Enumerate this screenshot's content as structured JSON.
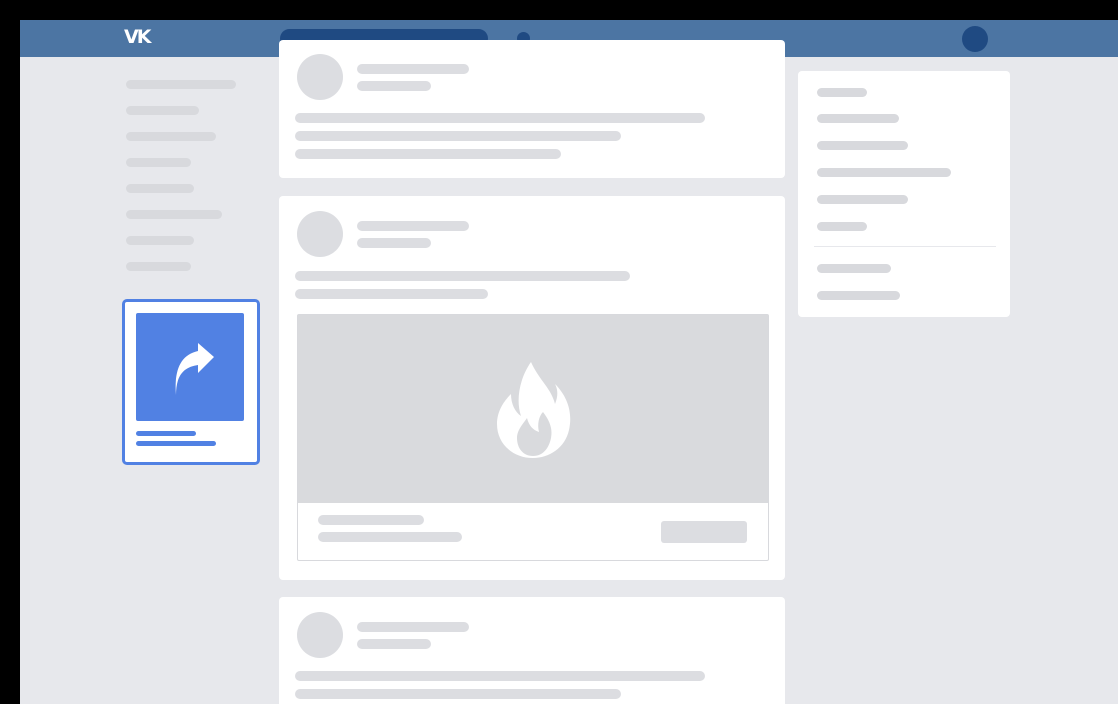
{
  "header": {
    "logo_text": "VK",
    "search_placeholder": "",
    "colors": {
      "bar": "#4c75a3",
      "dark": "#1f4a82"
    }
  },
  "sidebar": {
    "item_count": 8
  },
  "promo_app": {
    "icon": "share-arrow-icon",
    "color": "#5181e3"
  },
  "feed": {
    "posts": [
      {
        "kind": "text"
      },
      {
        "kind": "media",
        "media_icon": "flame-icon"
      },
      {
        "kind": "text"
      }
    ]
  },
  "right_menu": {
    "item_count": 8
  }
}
